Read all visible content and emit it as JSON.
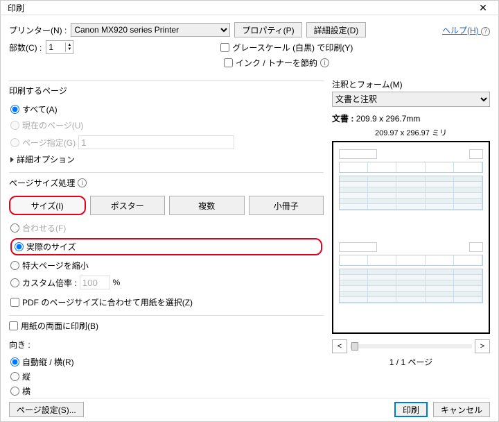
{
  "title": "印刷",
  "printer_label": "プリンター(N) :",
  "printer_selected": "Canon MX920 series Printer",
  "btn_properties": "プロパティ(P)",
  "btn_advanced": "詳細設定(D)",
  "help_label": "ヘルプ(H)",
  "copies_label": "部数(C) :",
  "copies_value": "1",
  "grayscale_label": "グレースケール (白黒) で印刷(Y)",
  "savetoner_label": "インク / トナーを節約",
  "pages_group": "印刷するページ",
  "pages_all": "すべて(A)",
  "pages_current": "現在のページ(U)",
  "pages_range": "ページ指定(G)",
  "pages_range_value": "1",
  "more_options": "詳細オプション",
  "sizing_group": "ページサイズ処理",
  "tab_size": "サイズ(I)",
  "tab_poster": "ポスター",
  "tab_multi": "複数",
  "tab_booklet": "小冊子",
  "fit": "合わせる(F)",
  "actual": "実際のサイズ",
  "shrink": "特大ページを縮小",
  "custom": "カスタム倍率 :",
  "custom_val": "100",
  "custom_pct": "%",
  "choose_paper": "PDF のページサイズに合わせて用紙を選択(Z)",
  "both_sides": "用紙の両面に印刷(B)",
  "orientation_label": "向き :",
  "orient_auto": "自動縦 / 横(R)",
  "orient_port": "縦",
  "orient_land": "横",
  "comments_label": "注釈とフォーム(M)",
  "comments_value": "文書と注釈",
  "doc_label": "文書 :",
  "doc_size": "209.9 x 296.7mm",
  "preview_size": "209.97 x 296.97 ミリ",
  "page_counter": "1 / 1 ページ",
  "nav_prev": "<",
  "nav_next": ">",
  "page_setup": "ページ設定(S)...",
  "btn_print": "印刷",
  "btn_cancel": "キャンセル",
  "info_glyph": "i"
}
